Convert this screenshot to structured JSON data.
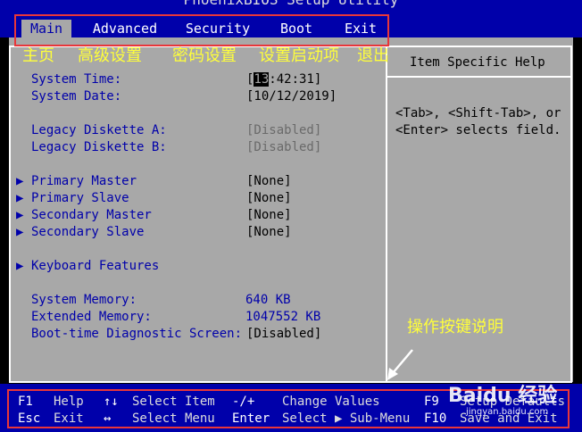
{
  "window": {
    "title": "PhoenixBIOS Setup Utility"
  },
  "menu": {
    "items": [
      "Main",
      "Advanced",
      "Security",
      "Boot",
      "Exit"
    ],
    "selected": "Main"
  },
  "annotations": {
    "tabs": [
      "主页",
      "高级设置",
      "密码设置",
      "设置启动项",
      "退出"
    ],
    "keys_note": "操作按键说明",
    "highlight_color": "#e8363a",
    "text_color": "#ffff3a"
  },
  "settings": {
    "system_time_label": "System Time:",
    "system_time_cursor": "13",
    "system_time_rest": ":42:31]",
    "system_date_label": "System Date:",
    "system_date_value": "[10/12/2019]",
    "legacy_a_label": "Legacy Diskette A:",
    "legacy_a_value": "[Disabled]",
    "legacy_b_label": "Legacy Diskette B:",
    "legacy_b_value": "[Disabled]",
    "drives": [
      {
        "label": "Primary Master",
        "value": "[None]"
      },
      {
        "label": "Primary Slave",
        "value": "[None]"
      },
      {
        "label": "Secondary Master",
        "value": "[None]"
      },
      {
        "label": "Secondary Slave",
        "value": "[None]"
      }
    ],
    "keyboard_label": "Keyboard Features",
    "system_memory_label": "System Memory:",
    "system_memory_value": "640 KB",
    "extended_memory_label": "Extended Memory:",
    "extended_memory_value": "1047552 KB",
    "boot_diag_label": "Boot-time Diagnostic Screen:",
    "boot_diag_value": "[Disabled]"
  },
  "help": {
    "title": "Item Specific Help",
    "line1": "<Tab>, <Shift-Tab>, or",
    "line2": "<Enter> selects field."
  },
  "keys": {
    "f1": "F1",
    "f1_desc": "Help",
    "updown": "↑↓",
    "updown_desc": "Select Item",
    "minusplus": "-/+",
    "minusplus_desc": "Change Values",
    "f9": "F9",
    "f9_desc": "Setup Defaults",
    "esc": "Esc",
    "esc_desc": "Exit",
    "leftright": "↔",
    "leftright_desc": "Select Menu",
    "enter": "Enter",
    "enter_desc": "Select ▶ Sub-Menu",
    "f10": "F10",
    "f10_desc": "Save and Exit"
  },
  "watermark": {
    "brand": "Baidu 经验",
    "url": "jingyan.baidu.com"
  }
}
